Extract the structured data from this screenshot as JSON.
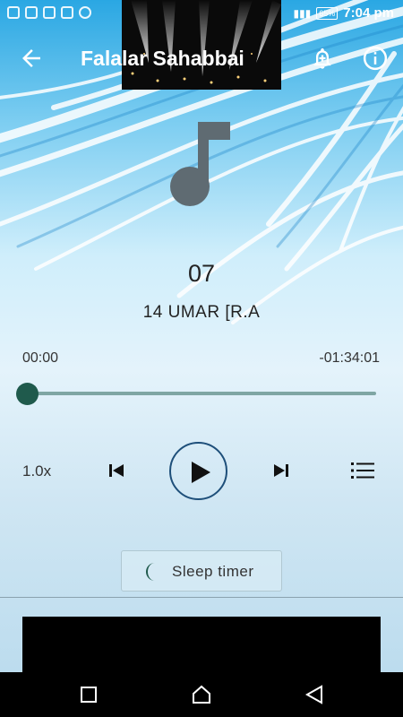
{
  "status_bar": {
    "time": "7:04 pm",
    "battery": "65%"
  },
  "toolbar": {
    "title": "Falalar Sahabbai"
  },
  "track": {
    "number": "07",
    "subtitle": "14 UMAR [R.A"
  },
  "progress": {
    "elapsed": "00:00",
    "remaining": "-01:34:01",
    "position_fraction": 0
  },
  "controls": {
    "speed": "1.0x"
  },
  "sleep_timer": {
    "label": "Sleep timer"
  },
  "colors": {
    "accent": "#1f5a4c",
    "play_ring": "#1e4f7a",
    "seek_track": "#7fa6a4"
  },
  "icons": [
    "back-arrow-icon",
    "bell-plus-icon",
    "info-icon",
    "music-note-icon",
    "skip-previous-icon",
    "play-icon",
    "skip-next-icon",
    "playlist-icon",
    "moon-icon",
    "recents-icon",
    "home-icon",
    "nav-back-icon"
  ]
}
